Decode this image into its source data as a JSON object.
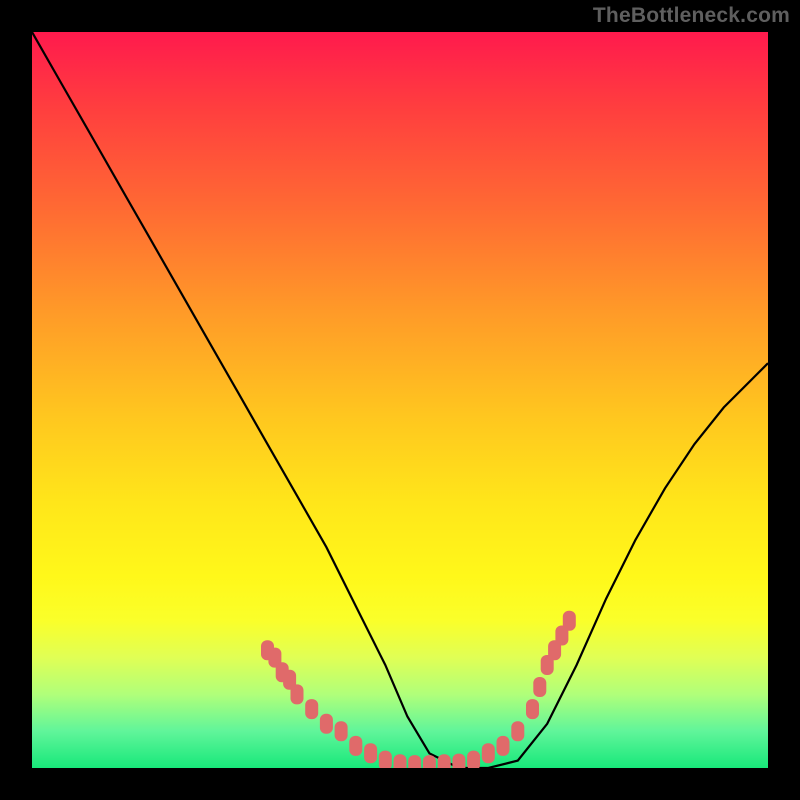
{
  "watermark": "TheBottleneck.com",
  "colors": {
    "page_bg": "#000000",
    "curve_stroke": "#000000",
    "marker_fill": "#e06a6a",
    "gradient_top": "#ff1a4d",
    "gradient_bottom": "#18e87a"
  },
  "chart_data": {
    "type": "line",
    "title": "",
    "xlabel": "",
    "ylabel": "",
    "xlim": [
      0,
      100
    ],
    "ylim": [
      0,
      100
    ],
    "grid": false,
    "legend": false,
    "series": [
      {
        "name": "bottleneck-curve",
        "x": [
          0,
          4,
          8,
          12,
          16,
          20,
          24,
          28,
          32,
          36,
          40,
          44,
          48,
          51,
          54,
          58,
          62,
          66,
          70,
          74,
          78,
          82,
          86,
          90,
          94,
          98,
          100
        ],
        "y": [
          100,
          93,
          86,
          79,
          72,
          65,
          58,
          51,
          44,
          37,
          30,
          22,
          14,
          7,
          2,
          0,
          0,
          1,
          6,
          14,
          23,
          31,
          38,
          44,
          49,
          53,
          55
        ]
      }
    ],
    "markers": {
      "name": "highlighted-points",
      "color": "#e06a6a",
      "points": [
        {
          "x": 32,
          "y": 16
        },
        {
          "x": 33,
          "y": 15
        },
        {
          "x": 34,
          "y": 13
        },
        {
          "x": 35,
          "y": 12
        },
        {
          "x": 36,
          "y": 10
        },
        {
          "x": 38,
          "y": 8
        },
        {
          "x": 40,
          "y": 6
        },
        {
          "x": 42,
          "y": 5
        },
        {
          "x": 44,
          "y": 3
        },
        {
          "x": 46,
          "y": 2
        },
        {
          "x": 48,
          "y": 1
        },
        {
          "x": 50,
          "y": 0.5
        },
        {
          "x": 52,
          "y": 0.4
        },
        {
          "x": 54,
          "y": 0.4
        },
        {
          "x": 56,
          "y": 0.5
        },
        {
          "x": 58,
          "y": 0.6
        },
        {
          "x": 60,
          "y": 1
        },
        {
          "x": 62,
          "y": 2
        },
        {
          "x": 64,
          "y": 3
        },
        {
          "x": 66,
          "y": 5
        },
        {
          "x": 68,
          "y": 8
        },
        {
          "x": 69,
          "y": 11
        },
        {
          "x": 70,
          "y": 14
        },
        {
          "x": 71,
          "y": 16
        },
        {
          "x": 72,
          "y": 18
        },
        {
          "x": 73,
          "y": 20
        }
      ]
    }
  }
}
